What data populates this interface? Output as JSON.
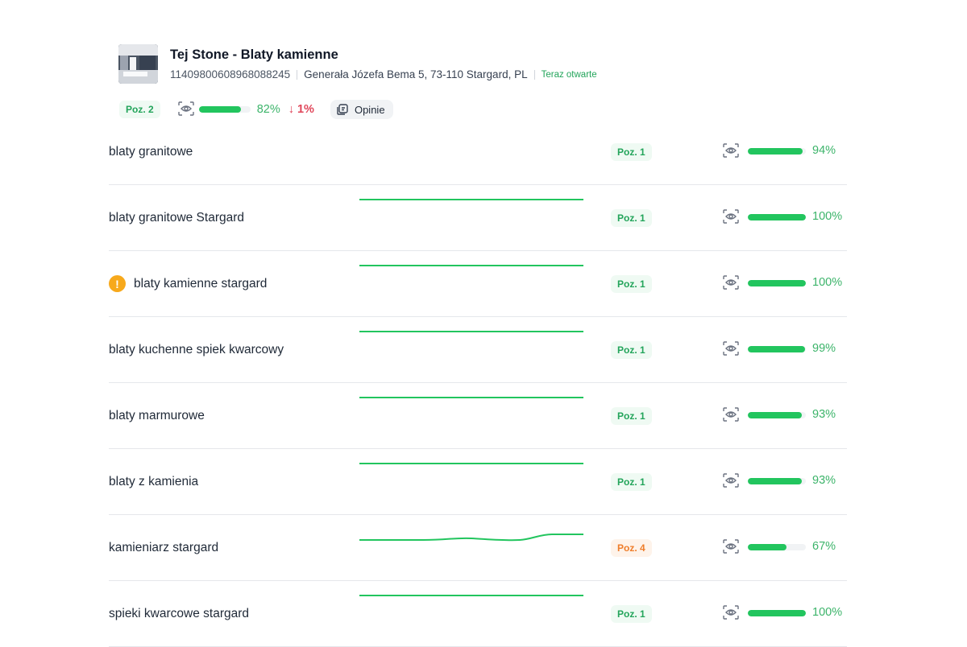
{
  "business": {
    "title": "Tej Stone - Blaty kamienne",
    "id": "11409800608968088245",
    "address": "Generała Józefa Bema 5, 73-110 Stargard, PL",
    "status": "Teraz otwarte",
    "status_color": "#22a45a"
  },
  "summary": {
    "position": "Poz. 2",
    "visibility_pct": "82%",
    "visibility_value": 0.82,
    "change": "↓ 1%",
    "reviews_button": "Opinie"
  },
  "colors": {
    "green": "#22c55e",
    "green_text": "#3cb46a",
    "orange": "#ef7d2a",
    "red": "#e0465a",
    "warning": "#f7a91c"
  },
  "keywords": [
    {
      "keyword": "blaty granitowe",
      "position": "Poz. 1",
      "pos_level": "green",
      "visibility_pct": "94%",
      "visibility_value": 0.94,
      "warning": false,
      "trend": "flat"
    },
    {
      "keyword": "blaty granitowe Stargard",
      "position": "Poz. 1",
      "pos_level": "green",
      "visibility_pct": "100%",
      "visibility_value": 1.0,
      "warning": false,
      "trend": "flat"
    },
    {
      "keyword": "blaty kamienne stargard",
      "position": "Poz. 1",
      "pos_level": "green",
      "visibility_pct": "100%",
      "visibility_value": 1.0,
      "warning": true,
      "warning_icon": "!",
      "trend": "flat"
    },
    {
      "keyword": "blaty kuchenne spiek kwarcowy",
      "position": "Poz. 1",
      "pos_level": "green",
      "visibility_pct": "99%",
      "visibility_value": 0.99,
      "warning": false,
      "trend": "flat"
    },
    {
      "keyword": "blaty marmurowe",
      "position": "Poz. 1",
      "pos_level": "green",
      "visibility_pct": "93%",
      "visibility_value": 0.93,
      "warning": false,
      "trend": "flat"
    },
    {
      "keyword": "blaty z kamienia",
      "position": "Poz. 1",
      "pos_level": "green",
      "visibility_pct": "93%",
      "visibility_value": 0.93,
      "warning": false,
      "trend": "flat"
    },
    {
      "keyword": "kamieniarz stargard",
      "position": "Poz. 4",
      "pos_level": "orange",
      "visibility_pct": "67%",
      "visibility_value": 0.67,
      "warning": false,
      "trend": "wave"
    },
    {
      "keyword": "spieki kwarcowe stargard",
      "position": "Poz. 1",
      "pos_level": "green",
      "visibility_pct": "100%",
      "visibility_value": 1.0,
      "warning": false,
      "trend": "flat"
    }
  ]
}
